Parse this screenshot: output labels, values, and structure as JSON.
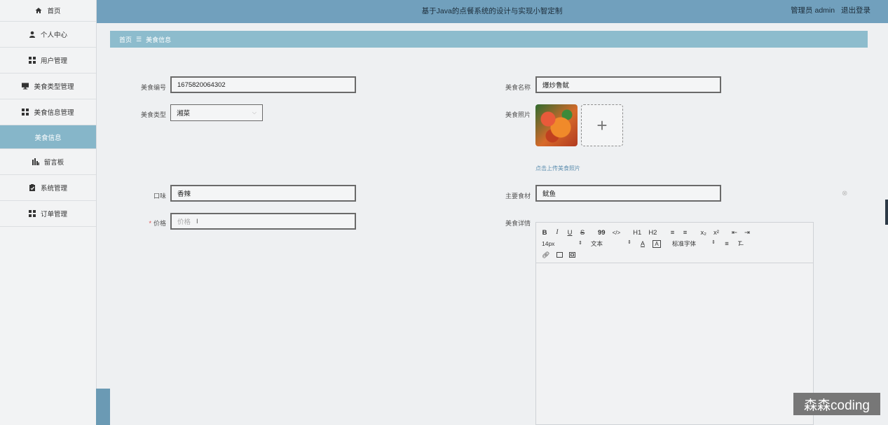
{
  "header": {
    "title": "基于Java的点餐系统的设计与实现小智定制",
    "user_role": "管理员 admin",
    "logout_label": "退出登录"
  },
  "sidebar": {
    "items": [
      {
        "label": "首页",
        "icon": "home-icon"
      },
      {
        "label": "个人中心",
        "icon": "user-icon"
      },
      {
        "label": "用户管理",
        "icon": "grid-icon"
      },
      {
        "label": "美食类型管理",
        "icon": "monitor-icon"
      },
      {
        "label": "美食信息管理",
        "icon": "grid-icon"
      },
      {
        "label": "美食信息",
        "icon": "",
        "active": true
      },
      {
        "label": "留言板",
        "icon": "chart-icon"
      },
      {
        "label": "系统管理",
        "icon": "clipboard-icon"
      },
      {
        "label": "订单管理",
        "icon": "grid-icon"
      }
    ]
  },
  "breadcrumb": {
    "home": "首页",
    "separator": "☰",
    "current": "美食信息"
  },
  "form": {
    "food_id": {
      "label": "美食编号",
      "value": "1675820064302"
    },
    "food_name": {
      "label": "美食名称",
      "value": "爆炒鲁鱿"
    },
    "food_type": {
      "label": "美食类型",
      "value": "湘菜"
    },
    "food_photo": {
      "label": "美食照片",
      "upload_tip": "点击上传美食照片"
    },
    "taste": {
      "label": "口味",
      "value": "香辣"
    },
    "main_ingredient": {
      "label": "主要食材",
      "value": "鱿鱼"
    },
    "price": {
      "label": "价格",
      "placeholder": "价格",
      "required_mark": "*"
    },
    "detail": {
      "label": "美食详情"
    }
  },
  "editor": {
    "font_size": "14px",
    "block_type": "文本",
    "font_family": "标准字体",
    "buttons_row1": [
      "B",
      "I",
      "U",
      "S",
      "99",
      "</>",
      "H1",
      "H2",
      "≡",
      "≡",
      "x₂",
      "x²",
      "⇤",
      "⇥"
    ]
  },
  "watermark": "森森coding",
  "colors": {
    "header_bg": "#71a0bd",
    "breadcrumb_bg": "#8dbccd",
    "active_item_bg": "#86b6c9",
    "required": "#e05050"
  }
}
